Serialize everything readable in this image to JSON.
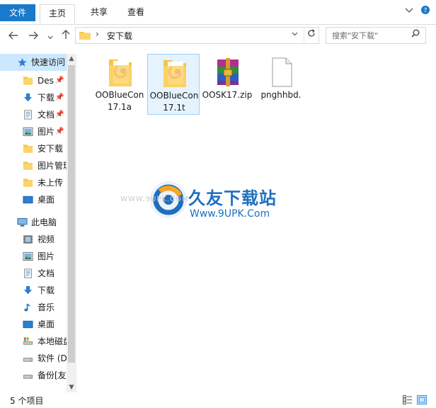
{
  "ribbon": {
    "tabs": [
      {
        "label": "文件"
      },
      {
        "label": "主页"
      },
      {
        "label": "共享"
      },
      {
        "label": "查看"
      }
    ]
  },
  "address": {
    "path": "安下载",
    "search_placeholder": "搜索\"安下载\""
  },
  "nav": {
    "items": [
      {
        "label": "快速访问",
        "icon": "star-icon",
        "pinned": false
      },
      {
        "label": "Des",
        "icon": "folder-icon",
        "pinned": true
      },
      {
        "label": "下载",
        "icon": "download-icon",
        "pinned": true
      },
      {
        "label": "文档",
        "icon": "document-icon",
        "pinned": true
      },
      {
        "label": "图片",
        "icon": "picture-icon",
        "pinned": true
      },
      {
        "label": "安下载",
        "icon": "folder-icon",
        "pinned": false
      },
      {
        "label": "图片管理",
        "icon": "folder-icon",
        "pinned": false
      },
      {
        "label": "未上传",
        "icon": "folder-icon",
        "pinned": false
      },
      {
        "label": "桌面",
        "icon": "desktop-icon",
        "pinned": false
      },
      {
        "label": "此电脑",
        "icon": "computer-icon",
        "pinned": false
      },
      {
        "label": "视频",
        "icon": "video-icon",
        "pinned": false
      },
      {
        "label": "图片",
        "icon": "picture-icon",
        "pinned": false
      },
      {
        "label": "文档",
        "icon": "document-icon",
        "pinned": false
      },
      {
        "label": "下载",
        "icon": "download-icon",
        "pinned": false
      },
      {
        "label": "音乐",
        "icon": "music-icon",
        "pinned": false
      },
      {
        "label": "桌面",
        "icon": "desktop-icon",
        "pinned": false
      },
      {
        "label": "本地磁盘",
        "icon": "drive-icon",
        "pinned": false
      },
      {
        "label": "软件 (D",
        "icon": "drive-icon",
        "pinned": false
      },
      {
        "label": "备份[友",
        "icon": "drive-icon",
        "pinned": false
      }
    ]
  },
  "files": [
    {
      "name": "OOBlueCon17.1a",
      "icon": "folder-icon",
      "selected": false
    },
    {
      "name": "OOBlueCon17.1t",
      "icon": "folder-icon",
      "selected": true
    },
    {
      "name": "OOSK17.zip",
      "icon": "winrar-archive-icon",
      "selected": false
    },
    {
      "name": "pnghhbd.",
      "icon": "blank-file-icon",
      "selected": false
    }
  ],
  "watermark": {
    "title": "久友下载站",
    "url_small": "WWW.9UPK.COM",
    "url": "Www.9UPK.Com"
  },
  "status": {
    "count": "5 个项目"
  },
  "colors": {
    "accent": "#1979ca",
    "selection": "#cce8ff",
    "folder": "#f5c443",
    "watermark": "#1f6fc0"
  }
}
